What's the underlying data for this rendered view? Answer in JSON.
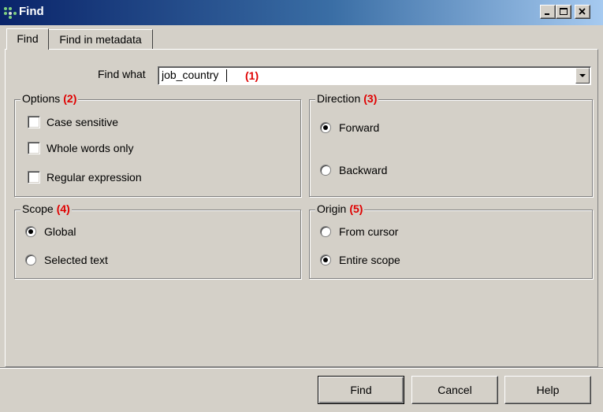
{
  "window": {
    "title": "Find",
    "icon": "find-app-icon",
    "controls": [
      "minimize",
      "maximize",
      "close"
    ]
  },
  "tabs": [
    {
      "label": "Find",
      "active": true
    },
    {
      "label": "Find in metadata",
      "active": false
    }
  ],
  "find_what": {
    "label": "Find what",
    "value": "job_country",
    "annotation": "(1)"
  },
  "options": {
    "title": "Options",
    "annotation": "(2)",
    "items": [
      {
        "label": "Case sensitive",
        "checked": false
      },
      {
        "label": "Whole words only",
        "checked": false
      },
      {
        "label": "Regular expression",
        "checked": false
      }
    ]
  },
  "direction": {
    "title": "Direction",
    "annotation": "(3)",
    "items": [
      {
        "label": "Forward",
        "selected": true
      },
      {
        "label": "Backward",
        "selected": false
      }
    ]
  },
  "scope": {
    "title": "Scope",
    "annotation": "(4)",
    "items": [
      {
        "label": "Global",
        "selected": true
      },
      {
        "label": "Selected text",
        "selected": false
      }
    ]
  },
  "origin": {
    "title": "Origin",
    "annotation": "(5)",
    "items": [
      {
        "label": "From cursor",
        "selected": false
      },
      {
        "label": "Entire scope",
        "selected": true
      }
    ]
  },
  "buttons": {
    "find": "Find",
    "cancel": "Cancel",
    "help": "Help"
  },
  "colors": {
    "title_bar_start": "#0a246a",
    "title_bar_end": "#a6caf0",
    "face": "#d4d0c8",
    "annotation": "#e00000"
  }
}
